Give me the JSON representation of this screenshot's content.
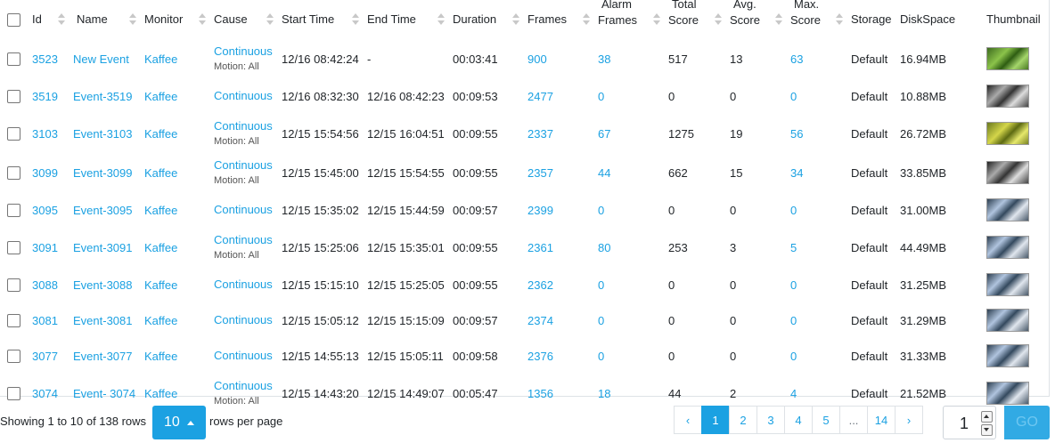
{
  "columns": {
    "id": "Id",
    "name": "Name",
    "monitor": "Monitor",
    "cause": "Cause",
    "start_time": "Start Time",
    "end_time": "End Time",
    "duration": "Duration",
    "frames": "Frames",
    "alarm_frames_1": "Alarm",
    "alarm_frames_2": "Frames",
    "total_score_1": "Total",
    "total_score_2": "Score",
    "avg_score_1": "Avg.",
    "avg_score_2": "Score",
    "max_score_1": "Max.",
    "max_score_2": "Score",
    "storage": "Storage",
    "disk_space": "DiskSpace",
    "thumbnail": "Thumbnail"
  },
  "rows": [
    {
      "id": "3523",
      "name": "New Event",
      "monitor": "Kaffee",
      "cause": "Continuous",
      "notes": "Motion: All",
      "start": "12/16 08:42:24",
      "end": "-",
      "duration": "00:03:41",
      "frames": "900",
      "alarm": "38",
      "total": "517",
      "avg": "13",
      "max": "63",
      "storage": "Default",
      "disk": "16.94MB",
      "thumb": "green-foliage-thumbnail"
    },
    {
      "id": "3519",
      "name": "Event-3519",
      "monitor": "Kaffee",
      "cause": "Continuous",
      "notes": "",
      "start": "12/16 08:32:30",
      "end": "12/16 08:42:23",
      "duration": "00:09:53",
      "frames": "2477",
      "alarm": "0",
      "total": "0",
      "avg": "0",
      "max": "0",
      "storage": "Default",
      "disk": "10.88MB",
      "thumb": "grayscale-thumbnail"
    },
    {
      "id": "3103",
      "name": "Event-3103",
      "monitor": "Kaffee",
      "cause": "Continuous",
      "notes": "Motion: All",
      "start": "12/15 15:54:56",
      "end": "12/15 16:04:51",
      "duration": "00:09:55",
      "frames": "2337",
      "alarm": "67",
      "total": "1275",
      "avg": "19",
      "max": "56",
      "storage": "Default",
      "disk": "26.72MB",
      "thumb": "yellow-foliage-thumbnail"
    },
    {
      "id": "3099",
      "name": "Event-3099",
      "monitor": "Kaffee",
      "cause": "Continuous",
      "notes": "Motion: All",
      "start": "12/15 15:45:00",
      "end": "12/15 15:54:55",
      "duration": "00:09:55",
      "frames": "2357",
      "alarm": "44",
      "total": "662",
      "avg": "15",
      "max": "34",
      "storage": "Default",
      "disk": "33.85MB",
      "thumb": "grayscale-thumbnail"
    },
    {
      "id": "3095",
      "name": "Event-3095",
      "monitor": "Kaffee",
      "cause": "Continuous",
      "notes": "",
      "start": "12/15 15:35:02",
      "end": "12/15 15:44:59",
      "duration": "00:09:57",
      "frames": "2399",
      "alarm": "0",
      "total": "0",
      "avg": "0",
      "max": "0",
      "storage": "Default",
      "disk": "31.00MB",
      "thumb": "blue-scene-thumbnail"
    },
    {
      "id": "3091",
      "name": "Event-3091",
      "monitor": "Kaffee",
      "cause": "Continuous",
      "notes": "Motion: All",
      "start": "12/15 15:25:06",
      "end": "12/15 15:35:01",
      "duration": "00:09:55",
      "frames": "2361",
      "alarm": "80",
      "total": "253",
      "avg": "3",
      "max": "5",
      "storage": "Default",
      "disk": "44.49MB",
      "thumb": "blue-scene-thumbnail"
    },
    {
      "id": "3088",
      "name": "Event-3088",
      "monitor": "Kaffee",
      "cause": "Continuous",
      "notes": "",
      "start": "12/15 15:15:10",
      "end": "12/15 15:25:05",
      "duration": "00:09:55",
      "frames": "2362",
      "alarm": "0",
      "total": "0",
      "avg": "0",
      "max": "0",
      "storage": "Default",
      "disk": "31.25MB",
      "thumb": "blue-scene-thumbnail"
    },
    {
      "id": "3081",
      "name": "Event-3081",
      "monitor": "Kaffee",
      "cause": "Continuous",
      "notes": "",
      "start": "12/15 15:05:12",
      "end": "12/15 15:15:09",
      "duration": "00:09:57",
      "frames": "2374",
      "alarm": "0",
      "total": "0",
      "avg": "0",
      "max": "0",
      "storage": "Default",
      "disk": "31.29MB",
      "thumb": "blue-scene-thumbnail"
    },
    {
      "id": "3077",
      "name": "Event-3077",
      "monitor": "Kaffee",
      "cause": "Continuous",
      "notes": "",
      "start": "12/15 14:55:13",
      "end": "12/15 15:05:11",
      "duration": "00:09:58",
      "frames": "2376",
      "alarm": "0",
      "total": "0",
      "avg": "0",
      "max": "0",
      "storage": "Default",
      "disk": "31.33MB",
      "thumb": "blue-scene-thumbnail"
    },
    {
      "id": "3074",
      "name": "Event- 3074",
      "monitor": "Kaffee",
      "cause": "Continuous",
      "notes": "Motion: All",
      "start": "12/15 14:43:20",
      "end": "12/15 14:49:07",
      "duration": "00:05:47",
      "frames": "1356",
      "alarm": "18",
      "total": "44",
      "avg": "2",
      "max": "4",
      "storage": "Default",
      "disk": "21.52MB",
      "thumb": "blue-scene-thumbnail"
    }
  ],
  "footer": {
    "showing_text": "Showing 1 to 10 of 138 rows",
    "rows_per_page_value": "10",
    "rows_per_page_label": "rows per page",
    "pages": [
      "‹",
      "1",
      "2",
      "3",
      "4",
      "5",
      "...",
      "14",
      "›"
    ],
    "active_page": "1",
    "goto_value": "1",
    "go_label": "GO"
  },
  "colors": {
    "accent": "#1ba1e2",
    "text": "#212529",
    "border": "#dee2e6"
  }
}
